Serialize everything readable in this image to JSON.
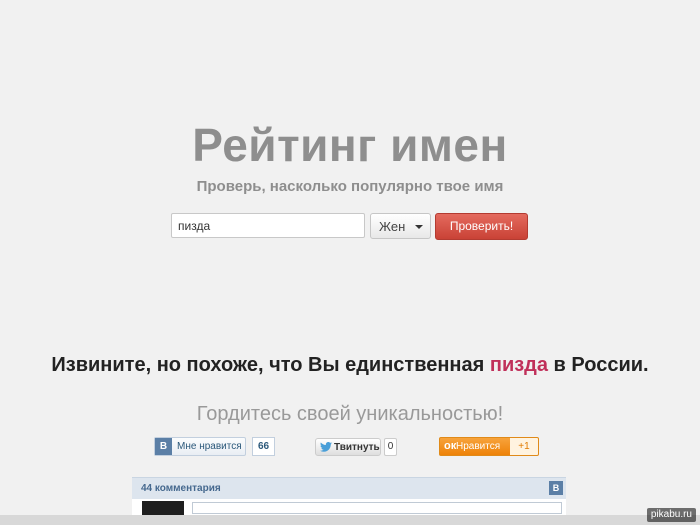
{
  "header": {
    "title": "Рейтинг имен",
    "subtitle": "Проверь, насколько популярно твое имя"
  },
  "search": {
    "value": "пизда",
    "gender_selected": "Жен",
    "submit_label": "Проверить!"
  },
  "result": {
    "message_before": "Извините, но похоже, что Вы единственная ",
    "message_name": "пизда",
    "message_after": " в России.",
    "pride_text": "Гордитесь своей уникальностью!"
  },
  "social": {
    "vk_logo": "B",
    "vk_label": "Мне нравится",
    "vk_count": "66",
    "twitter_label": "Твитнуть",
    "twitter_count": "0",
    "ok_logo": "ок",
    "ok_label": "Нравится",
    "ok_plus": "+1"
  },
  "comments": {
    "count_label": "44 комментария",
    "vk_logo": "B"
  },
  "watermark": "pikabu.ru",
  "colors": {
    "highlight_name": "#c0305a",
    "button_red": "#d9534f",
    "vk_blue": "#5b7fa6",
    "ok_orange": "#ee8208"
  }
}
